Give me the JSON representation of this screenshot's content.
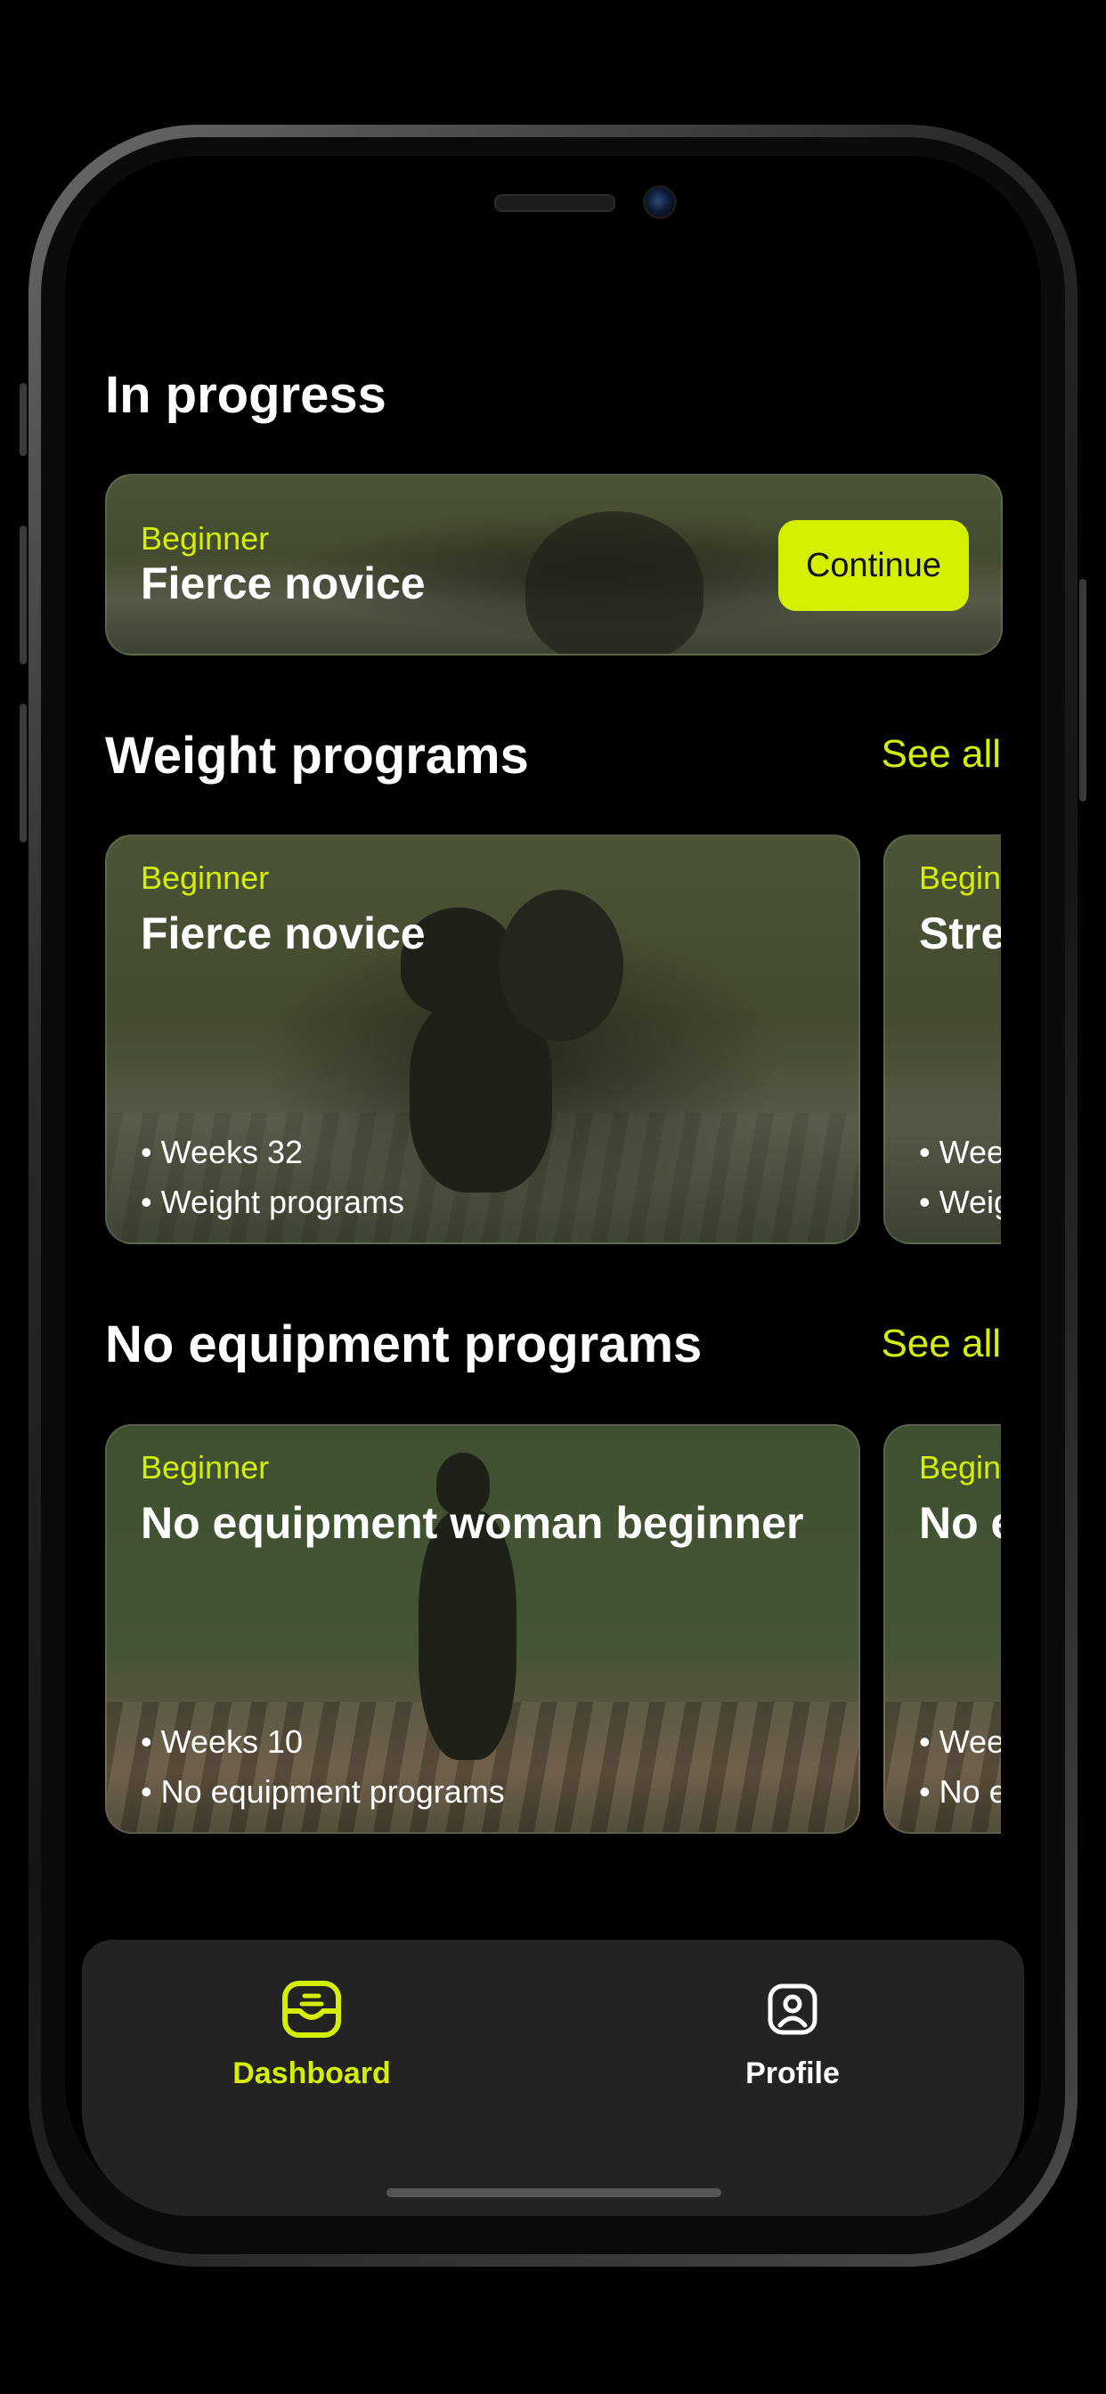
{
  "in_progress": {
    "heading": "In progress",
    "card": {
      "level": "Beginner",
      "title": "Fierce novice",
      "button_label": "Continue"
    }
  },
  "weight_programs": {
    "heading": "Weight programs",
    "see_all_label": "See all",
    "cards": [
      {
        "level": "Beginner",
        "title": "Fierce novice",
        "bullets": [
          "Weeks 32",
          "Weight programs"
        ]
      },
      {
        "level": "Beginner",
        "title": "Stre",
        "bullets": [
          "Wee",
          "Weig"
        ]
      }
    ]
  },
  "no_equipment_programs": {
    "heading": "No equipment programs",
    "see_all_label": "See all",
    "cards": [
      {
        "level": "Beginner",
        "title": "No equipment woman beginner",
        "bullets": [
          "Weeks 10",
          "No equipment programs"
        ]
      },
      {
        "level": "Beginner",
        "title": "No e",
        "bullets": [
          "Wee",
          "No e"
        ]
      }
    ]
  },
  "tab_bar": {
    "tabs": [
      {
        "label": "Dashboard",
        "icon": "dashboard-icon",
        "active": true
      },
      {
        "label": "Profile",
        "icon": "profile-icon",
        "active": false
      }
    ]
  },
  "colors": {
    "accent": "#d4f000",
    "background": "#000000",
    "tab_bar": "#232323"
  }
}
